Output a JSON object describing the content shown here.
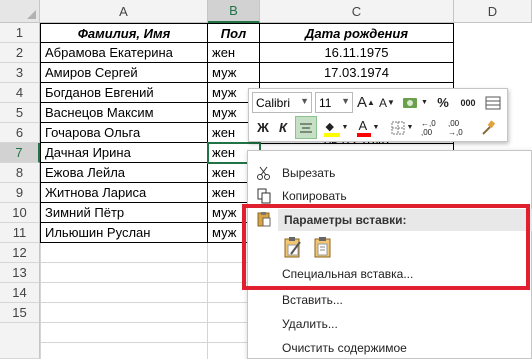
{
  "columns": [
    "A",
    "B",
    "C",
    "D"
  ],
  "rows": [
    "1",
    "2",
    "3",
    "4",
    "5",
    "6",
    "7",
    "8",
    "9",
    "10",
    "11",
    "12",
    "13",
    "14",
    "15"
  ],
  "headers": {
    "name": "Фамилия, Имя",
    "gender": "Пол",
    "birth": "Дата рождения"
  },
  "data_rows": [
    {
      "name": "Абрамова Екатерина",
      "gender": "жен",
      "birth": "16.11.1975"
    },
    {
      "name": "Амиров Сергей",
      "gender": "муж",
      "birth": "17.03.1974"
    },
    {
      "name": "Богданов Евгений",
      "gender": "муж",
      "birth": ""
    },
    {
      "name": "Васнецов Максим",
      "gender": "муж",
      "birth": ""
    },
    {
      "name": "Гочарова Ольга",
      "gender": "жен",
      "birth": "05.03.1949"
    },
    {
      "name": "Дачная Ирина",
      "gender": "жен",
      "birth": ""
    },
    {
      "name": "Ежова Лейла",
      "gender": "жен",
      "birth": ""
    },
    {
      "name": "Житнова Лариса",
      "gender": "жен",
      "birth": ""
    },
    {
      "name": "Зимний Пётр",
      "gender": "муж",
      "birth": ""
    },
    {
      "name": "Ильюшин Руслан",
      "gender": "муж",
      "birth": ""
    }
  ],
  "mini_toolbar": {
    "font_name": "Calibri",
    "font_size": "11",
    "grow_font": "A",
    "shrink_font": "A",
    "currency": "$",
    "percent": "%",
    "thousands": "000",
    "bold": "Ж",
    "italic": "К",
    "font_color_letter": "A",
    "dec_inc": "←,0 ,00",
    "dec_dec": ",00 →,0",
    "fill_color": "#ffff00",
    "font_color": "#ff0000"
  },
  "context_menu": {
    "cut": "Вырезать",
    "copy": "Копировать",
    "paste_options": "Параметры вставки:",
    "paste_special": "Специальная вставка...",
    "insert": "Вставить...",
    "delete": "Удалить...",
    "clear": "Очистить содержимое"
  },
  "colors": {
    "excel_green": "#217346",
    "highlight_red": "#e0202e"
  }
}
